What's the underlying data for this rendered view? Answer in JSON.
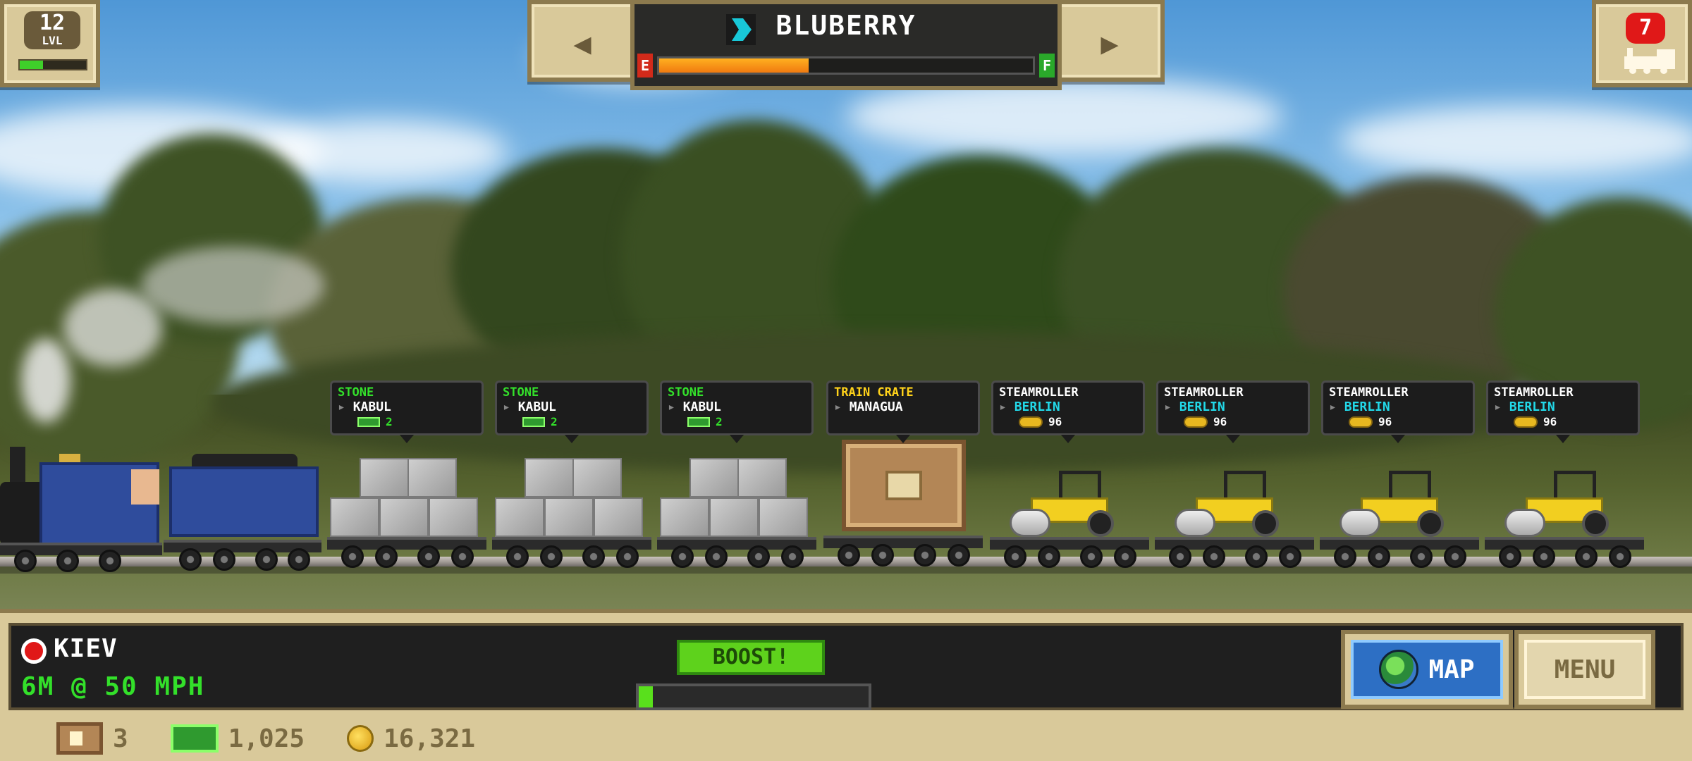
{
  "top": {
    "level": {
      "number": "12",
      "label": "LVL",
      "progress": 0.35
    },
    "locomotive_count": "7",
    "train_name": "BLUBERRY",
    "fuel": {
      "empty_label": "E",
      "full_label": "F",
      "level": 0.4
    }
  },
  "cargo": [
    {
      "type": "STONE",
      "type_color": "#33e02a",
      "destination": "KABUL",
      "dest_color": "#ffffff",
      "value": "2",
      "value_kind": "cash"
    },
    {
      "type": "STONE",
      "type_color": "#33e02a",
      "destination": "KABUL",
      "dest_color": "#ffffff",
      "value": "2",
      "value_kind": "cash"
    },
    {
      "type": "STONE",
      "type_color": "#33e02a",
      "destination": "KABUL",
      "dest_color": "#ffffff",
      "value": "2",
      "value_kind": "cash"
    },
    {
      "type": "TRAIN CRATE",
      "type_color": "#ffd21a",
      "destination": "MANAGUA",
      "dest_color": "#ffffff",
      "value": "",
      "value_kind": "none"
    },
    {
      "type": "STEAMROLLER",
      "type_color": "#ffffff",
      "destination": "BERLIN",
      "dest_color": "#22d8e8",
      "value": "96",
      "value_kind": "coin"
    },
    {
      "type": "STEAMROLLER",
      "type_color": "#ffffff",
      "destination": "BERLIN",
      "dest_color": "#22d8e8",
      "value": "96",
      "value_kind": "coin"
    },
    {
      "type": "STEAMROLLER",
      "type_color": "#ffffff",
      "destination": "BERLIN",
      "dest_color": "#22d8e8",
      "value": "96",
      "value_kind": "coin"
    },
    {
      "type": "STEAMROLLER",
      "type_color": "#ffffff",
      "destination": "BERLIN",
      "dest_color": "#22d8e8",
      "value": "96",
      "value_kind": "coin"
    }
  ],
  "hud": {
    "station": "KIEV",
    "speed": "6M @ 50 MPH",
    "boost_label": "BOOST!",
    "boost_progress": 0.06,
    "map_label": "MAP",
    "menu_label": "MENU"
  },
  "resources": {
    "crates": "3",
    "cash": "1,025",
    "coins": "16,321"
  }
}
